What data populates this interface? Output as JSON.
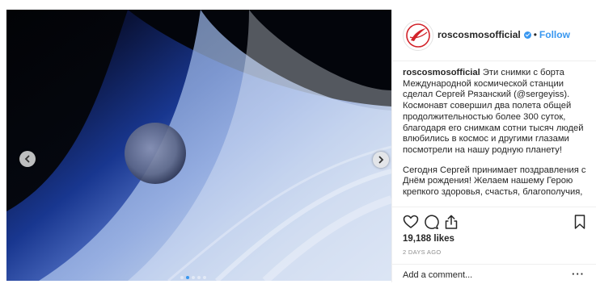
{
  "post": {
    "username": "roscosmosofficial",
    "separator": "•",
    "follow_label": "Follow",
    "caption_user": "roscosmosofficial",
    "caption_p1": "Эти снимки с борта Международной космической станции сделал Сергей Рязанский (@sergeyiss). Космонавт совершил два полета общей продолжительностью более 300 суток, благодаря его снимкам сотни тысяч людей влюбились в космос и другими глазами посмотрели на нашу родную планету!",
    "caption_p2": "Сегодня Сергей принимает поздравления с Днём рождения! Желаем нашему Герою крепкого здоровья, счастья, благополучия,",
    "likes": "19,188 likes",
    "time_ago": "2 DAYS AGO",
    "comment_placeholder": "Add a comment...",
    "more": "···"
  },
  "carousel": {
    "dot_count": 5,
    "active_index": 1
  },
  "icons": {
    "prev": "chevron-left-icon",
    "next": "chevron-right-icon",
    "like": "heart-icon",
    "comment": "comment-bubble-icon",
    "share": "share-icon",
    "save": "bookmark-icon",
    "verified": "verified-badge-icon"
  },
  "colors": {
    "accent": "#3897f0",
    "text": "#262626",
    "muted": "#8e8e8e",
    "divider": "#efefef",
    "logo_red": "#d2232a"
  }
}
